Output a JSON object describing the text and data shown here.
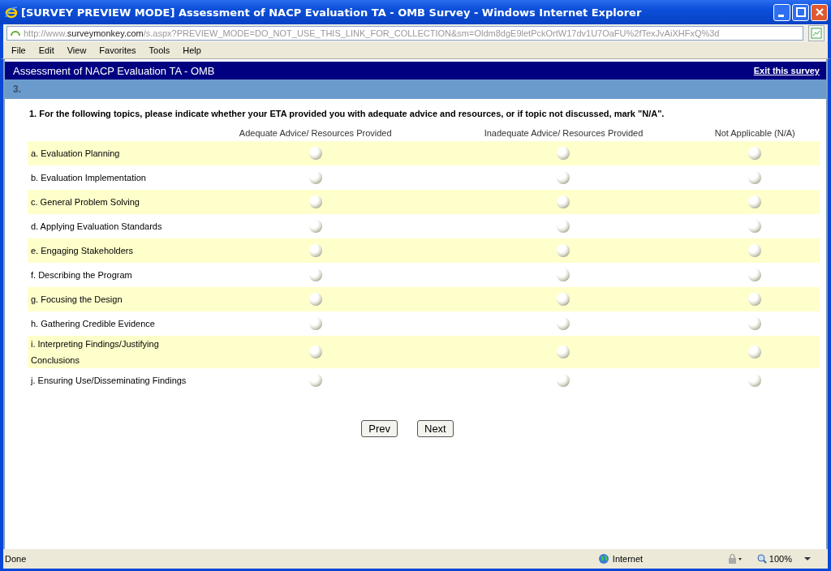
{
  "window": {
    "title": "[SURVEY PREVIEW MODE] Assessment of NACP Evaluation TA - OMB Survey - Windows Internet Explorer"
  },
  "address": {
    "prefix": "http://www.",
    "domain": "surveymonkey.com",
    "path": "/s.aspx?PREVIEW_MODE=DO_NOT_USE_THIS_LINK_FOR_COLLECTION&sm=Oldm8dgE9letPckOrtW17dv1U7OaFU%2fTexJvAiXHFxQ%3d"
  },
  "menu": [
    "File",
    "Edit",
    "View",
    "Favorites",
    "Tools",
    "Help"
  ],
  "survey": {
    "title": "Assessment of NACP Evaluation TA - OMB",
    "exit_link": "Exit this survey",
    "page_number": "3.",
    "question": {
      "number": "1.",
      "text": "For the following topics, please indicate whether your ETA provided you with adequate advice and resources, or if topic not discussed, mark \"N/A\".",
      "columns": [
        "Adequate Advice/ Resources Provided",
        "Inadequate Advice/ Resources Provided",
        "Not Applicable (N/A)"
      ],
      "rows": [
        {
          "label": "a. Evaluation Planning",
          "options": [
            {
              "selected": false
            },
            {
              "selected": false
            },
            {
              "selected": false
            }
          ]
        },
        {
          "label": "b. Evaluation Implementation",
          "options": [
            {
              "selected": false
            },
            {
              "selected": false
            },
            {
              "selected": false
            }
          ]
        },
        {
          "label": "c. General Problem Solving",
          "options": [
            {
              "selected": false
            },
            {
              "selected": false
            },
            {
              "selected": false
            }
          ]
        },
        {
          "label": "d. Applying Evaluation Standards",
          "options": [
            {
              "selected": false
            },
            {
              "selected": false
            },
            {
              "selected": false
            }
          ]
        },
        {
          "label": "e. Engaging Stakeholders",
          "options": [
            {
              "selected": false
            },
            {
              "selected": false
            },
            {
              "selected": false
            }
          ]
        },
        {
          "label": "f. Describing the Program",
          "options": [
            {
              "selected": false
            },
            {
              "selected": false
            },
            {
              "selected": false
            }
          ]
        },
        {
          "label": "g. Focusing the Design",
          "options": [
            {
              "selected": false
            },
            {
              "selected": false
            },
            {
              "selected": false
            }
          ]
        },
        {
          "label": "h. Gathering Credible Evidence",
          "options": [
            {
              "selected": false
            },
            {
              "selected": false
            },
            {
              "selected": false
            }
          ]
        },
        {
          "label": "i. Interpreting Findings/Justifying Conclusions",
          "options": [
            {
              "selected": false
            },
            {
              "selected": false
            },
            {
              "selected": false
            }
          ]
        },
        {
          "label": "j. Ensuring Use/Disseminating Findings",
          "options": [
            {
              "selected": false
            },
            {
              "selected": false
            },
            {
              "selected": false
            }
          ]
        }
      ]
    },
    "buttons": [
      "Prev",
      "Next"
    ]
  },
  "status_bar": {
    "text": "Done",
    "zone": "Internet",
    "zoom": "100%"
  }
}
